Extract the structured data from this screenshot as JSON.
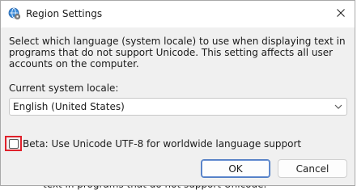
{
  "background_text": "text in programs that do not support Unicode.",
  "dialog": {
    "title": "Region Settings",
    "title_icon": "globe-settings-icon",
    "close_icon": "close-icon",
    "description": "Select which language (system locale) to use when displaying text in programs that do not support Unicode. This setting affects all user accounts on the computer.",
    "locale_label": "Current system locale:",
    "locale_select": {
      "value": "English (United States)",
      "icon": "chevron-down-icon"
    },
    "beta_checkbox": {
      "label": "Beta: Use Unicode UTF-8 for worldwide language support",
      "checked": false,
      "highlight_color": "#e0212b"
    },
    "buttons": {
      "ok": "OK",
      "cancel": "Cancel"
    }
  }
}
